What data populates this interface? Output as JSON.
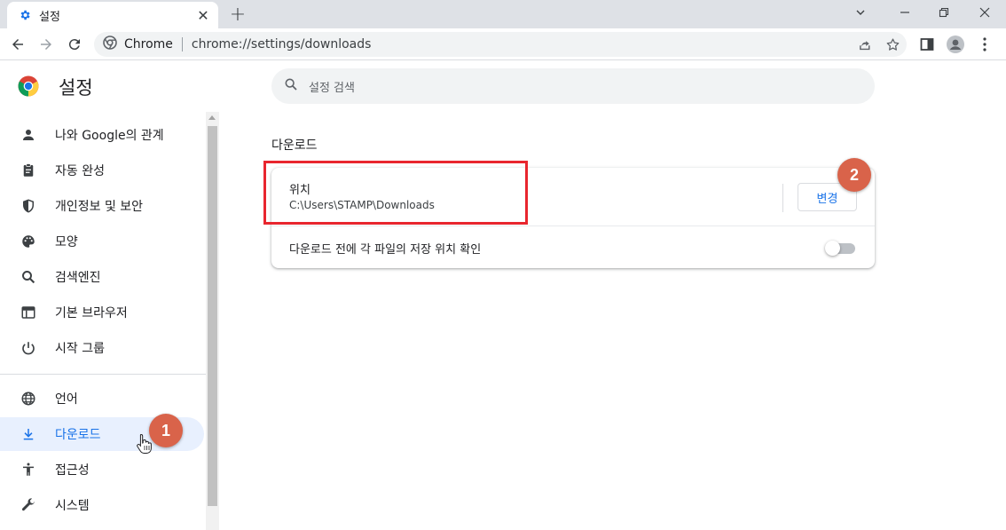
{
  "tab": {
    "title": "설정"
  },
  "toolbar": {
    "site_label": "Chrome",
    "url": "chrome://settings/downloads"
  },
  "page": {
    "title": "설정",
    "search_placeholder": "설정 검색"
  },
  "sidebar": {
    "items": [
      {
        "label": "나와 Google의 관계",
        "icon": "person-icon"
      },
      {
        "label": "자동 완성",
        "icon": "clipboard-icon"
      },
      {
        "label": "개인정보 및 보안",
        "icon": "shield-icon"
      },
      {
        "label": "모양",
        "icon": "palette-icon"
      },
      {
        "label": "검색엔진",
        "icon": "search-icon"
      },
      {
        "label": "기본 브라우저",
        "icon": "browser-icon"
      },
      {
        "label": "시작 그룹",
        "icon": "power-icon"
      },
      {
        "label": "언어",
        "icon": "globe-icon"
      },
      {
        "label": "다운로드",
        "icon": "download-icon",
        "active": true
      },
      {
        "label": "접근성",
        "icon": "accessibility-icon"
      },
      {
        "label": "시스템",
        "icon": "wrench-icon"
      }
    ]
  },
  "downloads": {
    "section_title": "다운로드",
    "location_label": "위치",
    "location_path": "C:\\Users\\STAMP\\Downloads",
    "change_button": "변경",
    "ask_label": "다운로드 전에 각 파일의 저장 위치 확인",
    "ask_enabled": false
  },
  "annotations": {
    "badge1": "1",
    "badge2": "2"
  },
  "colors": {
    "accent": "#1a73e8",
    "highlight": "#e8262e",
    "badge": "#d9634a"
  }
}
